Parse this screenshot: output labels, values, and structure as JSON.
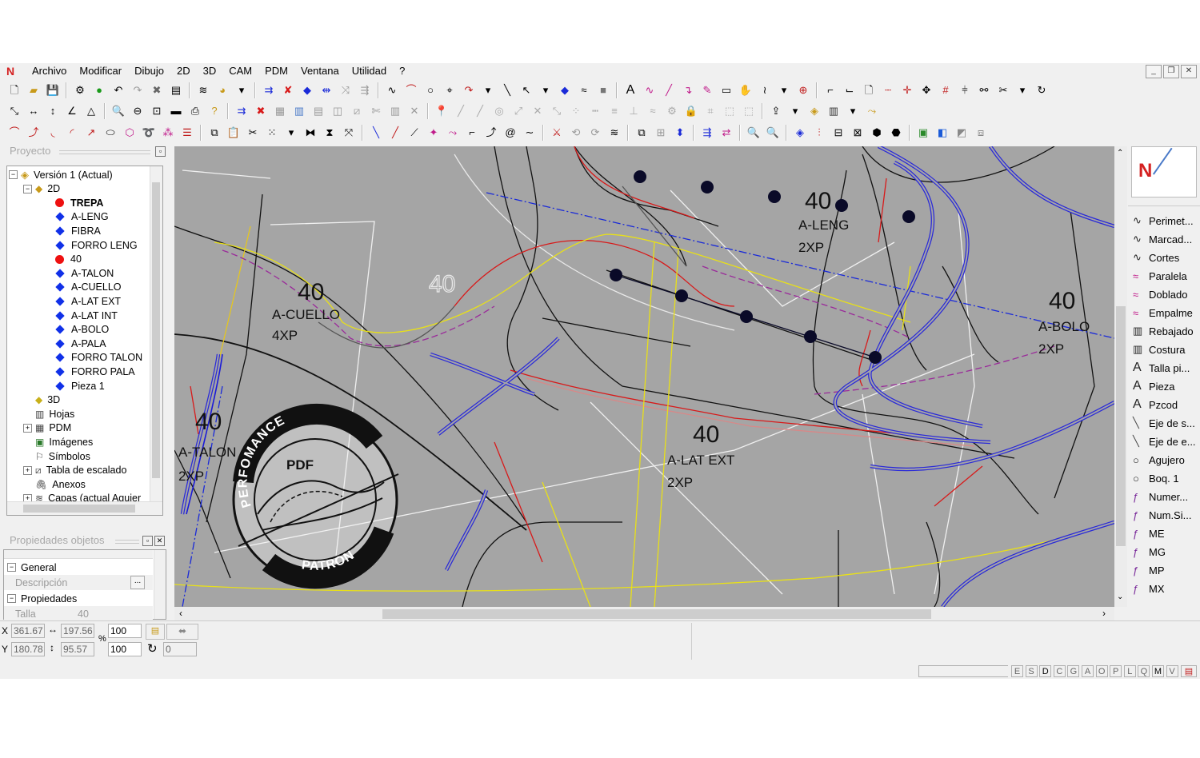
{
  "menu": [
    "Archivo",
    "Modificar",
    "Dibujo",
    "2D",
    "3D",
    "CAM",
    "PDM",
    "Ventana",
    "Utilidad",
    "?"
  ],
  "project_panel": {
    "title": "Proyecto",
    "tree": [
      {
        "label": "Versión 1 (Actual)",
        "icon": "version-icon",
        "level": 0,
        "expand": "−"
      },
      {
        "label": "2D",
        "icon": "2d-icon",
        "level": 1,
        "expand": "−"
      },
      {
        "label": "TREPA",
        "icon": "red-dot",
        "level": 2,
        "bold": true
      },
      {
        "label": "A-LENG",
        "icon": "blue-diamond",
        "level": 2
      },
      {
        "label": "FIBRA",
        "icon": "blue-diamond",
        "level": 2
      },
      {
        "label": "FORRO LENG",
        "icon": "blue-diamond",
        "level": 2
      },
      {
        "label": "40",
        "icon": "red-dot",
        "level": 2
      },
      {
        "label": "A-TALON",
        "icon": "blue-diamond",
        "level": 2
      },
      {
        "label": "A-CUELLO",
        "icon": "blue-diamond",
        "level": 2
      },
      {
        "label": "A-LAT EXT",
        "icon": "blue-diamond",
        "level": 2
      },
      {
        "label": "A-LAT INT",
        "icon": "blue-diamond",
        "level": 2
      },
      {
        "label": "A-BOLO",
        "icon": "blue-diamond",
        "level": 2
      },
      {
        "label": "A-PALA",
        "icon": "blue-diamond",
        "level": 2
      },
      {
        "label": "FORRO TALON",
        "icon": "blue-diamond",
        "level": 2
      },
      {
        "label": "FORRO PALA",
        "icon": "blue-diamond",
        "level": 2
      },
      {
        "label": "Pieza 1",
        "icon": "blue-diamond",
        "level": 2
      },
      {
        "label": "3D",
        "icon": "3d-icon",
        "level": 1
      },
      {
        "label": "Hojas",
        "icon": "sheets-icon",
        "level": 1
      },
      {
        "label": "PDM",
        "icon": "pdm-icon",
        "level": 1,
        "expand": "+"
      },
      {
        "label": "Imágenes",
        "icon": "images-icon",
        "level": 1
      },
      {
        "label": "Símbolos",
        "icon": "symbols-icon",
        "level": 1
      },
      {
        "label": "Tabla de escalado",
        "icon": "table-icon",
        "level": 1,
        "expand": "+"
      },
      {
        "label": "Anexos",
        "icon": "attach-icon",
        "level": 1
      },
      {
        "label": "Capas (actual Agujer",
        "icon": "layers-icon",
        "level": 1,
        "expand": "+"
      }
    ]
  },
  "properties_panel": {
    "title": "Propiedades objetos",
    "general": "General",
    "descripcion": "Descripción",
    "descripcion_btn": "...",
    "propiedades": "Propiedades",
    "talla_label": "Talla",
    "talla_value": "40"
  },
  "canvas": {
    "labels": [
      {
        "text": "40",
        "size": "big"
      },
      {
        "text": "A-LENG",
        "size": "mid"
      },
      {
        "text": "2XP",
        "size": "mid"
      },
      {
        "text": "40",
        "size": "big"
      },
      {
        "text": "A-CUELLO",
        "size": "mid"
      },
      {
        "text": "4XP",
        "size": "mid"
      },
      {
        "text": "40",
        "size": "outline"
      },
      {
        "text": "40",
        "size": "big"
      },
      {
        "text": "A-BOLO",
        "size": "mid"
      },
      {
        "text": "2XP",
        "size": "mid"
      },
      {
        "text": "40",
        "size": "big"
      },
      {
        "text": "A-TALON",
        "size": "mid"
      },
      {
        "text": "2XP",
        "size": "mid"
      },
      {
        "text": "40",
        "size": "big"
      },
      {
        "text": "A-LAT EXT",
        "size": "mid"
      },
      {
        "text": "2XP",
        "size": "mid"
      }
    ],
    "watermark": {
      "top": "PERFOMANCE",
      "middle": "PDF",
      "bottom": "PATRON"
    }
  },
  "right_panel": {
    "items": [
      {
        "label": "Perimet...",
        "icon": "curve-icon"
      },
      {
        "label": "Marcad...",
        "icon": "curve-icon"
      },
      {
        "label": "Cortes",
        "icon": "curve-icon"
      },
      {
        "label": "Paralela",
        "icon": "double-curve-icon"
      },
      {
        "label": "Doblado",
        "icon": "double-curve-icon"
      },
      {
        "label": "Empalme",
        "icon": "double-curve-icon"
      },
      {
        "label": "Rebajado",
        "icon": "ribbon-icon"
      },
      {
        "label": "Costura",
        "icon": "ribbon-icon"
      },
      {
        "label": "Talla pi...",
        "icon": "text-a-icon"
      },
      {
        "label": "Pieza",
        "icon": "text-a-icon"
      },
      {
        "label": "Pzcod",
        "icon": "text-a-icon"
      },
      {
        "label": "Eje de s...",
        "icon": "axis-icon"
      },
      {
        "label": "Eje de e...",
        "icon": "axis-icon"
      },
      {
        "label": "Agujero",
        "icon": "circle-icon"
      },
      {
        "label": "Boq. 1",
        "icon": "circle-icon"
      },
      {
        "label": "Numer...",
        "icon": "marker-icon"
      },
      {
        "label": "Num.Si...",
        "icon": "marker-icon"
      },
      {
        "label": "ME",
        "icon": "marker-icon"
      },
      {
        "label": "MG",
        "icon": "marker-icon"
      },
      {
        "label": "MP",
        "icon": "marker-icon"
      },
      {
        "label": "MX",
        "icon": "marker-icon"
      }
    ]
  },
  "coords": {
    "x_label": "X",
    "x_value": "361.67",
    "w_value": "197.56",
    "y_label": "Y",
    "y_value": "180.78",
    "h_value": "95.57",
    "pct": "%",
    "scale_x": "100",
    "scale_y": "100",
    "rot": "0"
  },
  "statusbar": [
    "E",
    "S",
    "D",
    "C",
    "G",
    "A",
    "O",
    "P",
    "L",
    "Q",
    "M",
    "V"
  ]
}
